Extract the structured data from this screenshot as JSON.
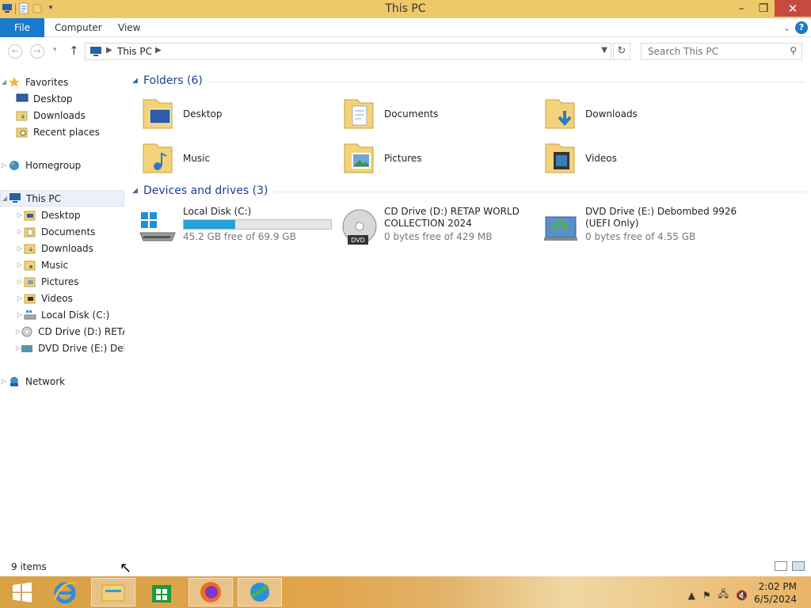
{
  "window": {
    "title": "This PC"
  },
  "ribbon": {
    "file": "File",
    "tabs": [
      "Computer",
      "View"
    ]
  },
  "address": {
    "crumb": "This PC"
  },
  "search": {
    "placeholder": "Search This PC"
  },
  "nav": {
    "favorites": {
      "label": "Favorites",
      "items": [
        "Desktop",
        "Downloads",
        "Recent places"
      ]
    },
    "homegroup": "Homegroup",
    "thispc": {
      "label": "This PC",
      "items": [
        "Desktop",
        "Documents",
        "Downloads",
        "Music",
        "Pictures",
        "Videos",
        "Local Disk (C:)",
        "CD Drive (D:) RETAP",
        "DVD Drive (E:) Debor"
      ]
    },
    "network": "Network"
  },
  "folders": {
    "header": "Folders (6)",
    "items": [
      "Desktop",
      "Documents",
      "Downloads",
      "Music",
      "Pictures",
      "Videos"
    ]
  },
  "drives": {
    "header": "Devices and drives (3)",
    "items": [
      {
        "name": "Local Disk (C:)",
        "free": "45.2 GB free of 69.9 GB",
        "used_fraction": 0.35
      },
      {
        "name": "CD Drive (D:) RETAP WORLD COLLECTION 2024",
        "free": "0 bytes free of 429 MB"
      },
      {
        "name": "DVD Drive (E:) Debombed 9926 (UEFI Only)",
        "free": "0 bytes free of 4.55 GB"
      }
    ]
  },
  "status": {
    "items": "9 items"
  },
  "taskbar": {
    "time": "2:02 PM",
    "date": "6/5/2024"
  },
  "colors": {
    "titlebar": "#eec96a",
    "accent": "#1979ca",
    "selection": "#eaf1fb",
    "close": "#c74a3f"
  }
}
